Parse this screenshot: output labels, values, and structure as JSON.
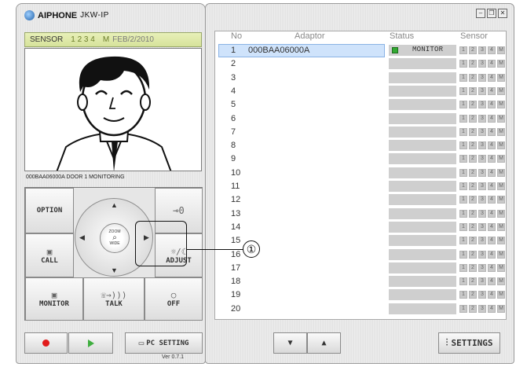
{
  "app": {
    "brand": "AIPHONE",
    "product": "JKW-IP",
    "version": "Ver 0.7.1"
  },
  "sensor_bar": {
    "label": "SENSOR",
    "numbers": "1 2 3 4",
    "mode": "M",
    "date": "FEB/2/2010"
  },
  "video": {
    "caption": "000BAA06000A DOOR 1 MONITORING"
  },
  "controls": {
    "option": "OPTION",
    "key_icon": "⊸0",
    "call": "CALL",
    "adjust": "ADJUST",
    "adjust_icon": "☼/☾",
    "monitor": "MONITOR",
    "talk": "TALK",
    "off": "OFF",
    "zoom_top": "ZOOM",
    "zoom_bottom": "WIDE"
  },
  "bottom_left": {
    "record_icon": "record-icon",
    "play_icon": "play-icon",
    "pc_setting": "PC SETTING"
  },
  "window_controls": {
    "minimize": "–",
    "restore": "❐",
    "close": "✕"
  },
  "table": {
    "headers": {
      "no": "No",
      "adaptor": "Adaptor",
      "status": "Status",
      "sensor": "Sensor"
    },
    "sensor_labels": [
      "1",
      "2",
      "3",
      "4",
      "M"
    ],
    "rows": [
      {
        "no": "1",
        "adaptor": "000BAA06000A",
        "status": "MONITOR",
        "selected": true
      },
      {
        "no": "2",
        "adaptor": "",
        "status": ""
      },
      {
        "no": "3",
        "adaptor": "",
        "status": ""
      },
      {
        "no": "4",
        "adaptor": "",
        "status": ""
      },
      {
        "no": "5",
        "adaptor": "",
        "status": ""
      },
      {
        "no": "6",
        "adaptor": "",
        "status": ""
      },
      {
        "no": "7",
        "adaptor": "",
        "status": ""
      },
      {
        "no": "8",
        "adaptor": "",
        "status": ""
      },
      {
        "no": "9",
        "adaptor": "",
        "status": ""
      },
      {
        "no": "10",
        "adaptor": "",
        "status": ""
      },
      {
        "no": "11",
        "adaptor": "",
        "status": ""
      },
      {
        "no": "12",
        "adaptor": "",
        "status": ""
      },
      {
        "no": "13",
        "adaptor": "",
        "status": ""
      },
      {
        "no": "14",
        "adaptor": "",
        "status": ""
      },
      {
        "no": "15",
        "adaptor": "",
        "status": ""
      },
      {
        "no": "16",
        "adaptor": "",
        "status": ""
      },
      {
        "no": "17",
        "adaptor": "",
        "status": ""
      },
      {
        "no": "18",
        "adaptor": "",
        "status": ""
      },
      {
        "no": "19",
        "adaptor": "",
        "status": ""
      },
      {
        "no": "20",
        "adaptor": "",
        "status": ""
      }
    ]
  },
  "right_bottom": {
    "down": "▼",
    "up": "▲",
    "settings": "SETTINGS"
  },
  "callout": {
    "number": "①"
  },
  "colors": {
    "record": "#e11b1b",
    "play": "#3fae3f",
    "monitor_dot": "#33aa33",
    "selection": "#cfe3fb"
  }
}
